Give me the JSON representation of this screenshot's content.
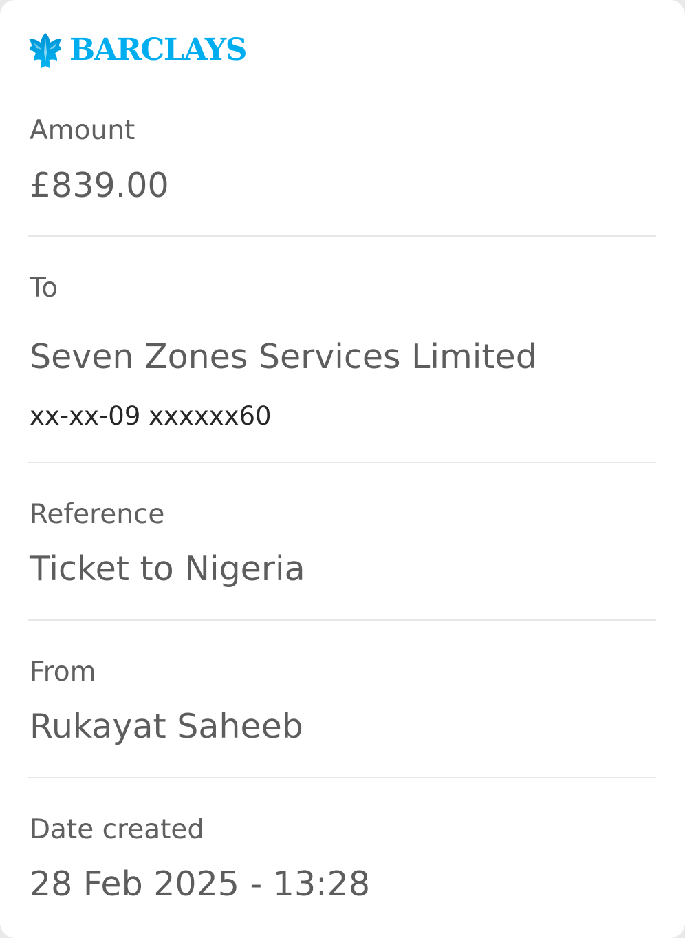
{
  "brand": {
    "name": "BARCLAYS",
    "icon": "eagle-icon",
    "color": "#00aeef"
  },
  "details": {
    "amount": {
      "label": "Amount",
      "value": "£839.00"
    },
    "to": {
      "label": "To",
      "name": "Seven Zones Services Limited",
      "account": "xx-xx-09 xxxxxx60"
    },
    "reference": {
      "label": "Reference",
      "value": "Ticket to Nigeria"
    },
    "from": {
      "label": "From",
      "value": "Rukayat Saheeb"
    },
    "date_created": {
      "label": "Date created",
      "value": "28 Feb 2025 - 13:28"
    }
  }
}
